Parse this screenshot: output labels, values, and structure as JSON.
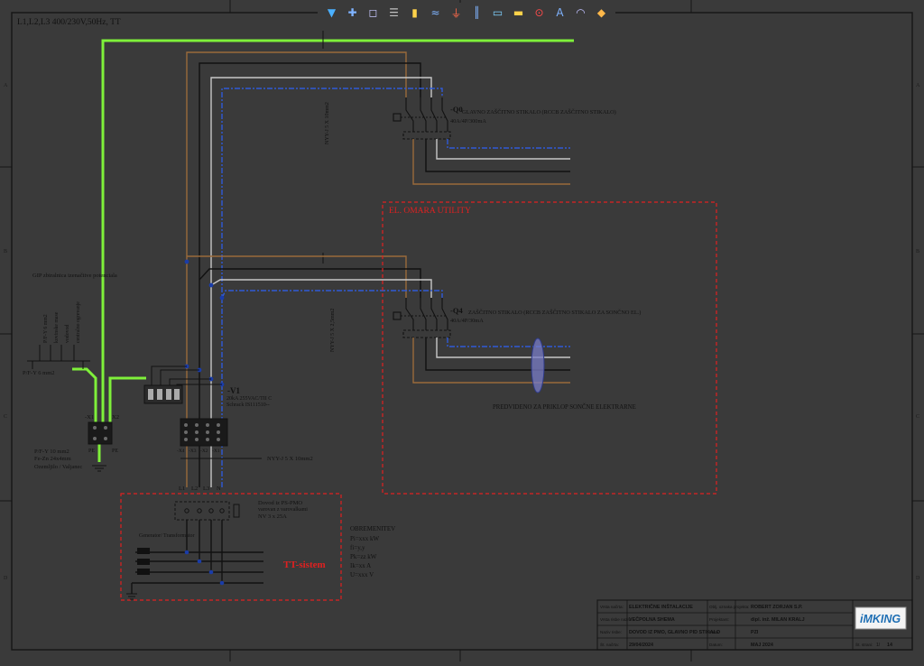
{
  "header": {
    "supply": "L1,L2,L3 400/230V,50Hz, TT"
  },
  "toolbar": {
    "icons": [
      "filter-icon",
      "crosshair-icon",
      "select-box-icon",
      "layers-icon",
      "component-icon",
      "wire-icon",
      "ground-icon",
      "bus-icon",
      "terminal-icon",
      "label-icon",
      "warning-icon",
      "text-icon",
      "arc-icon",
      "measure-icon"
    ],
    "glyphs": [
      "▼",
      "✚",
      "◻",
      "☰",
      "▮",
      "≈",
      "⏚",
      "║",
      "▭",
      "▬",
      "⊙",
      "A",
      "◠",
      "◆"
    ],
    "colors": [
      "#4ab0ff",
      "#7fb3ff",
      "#c8c8ff",
      "#c0c0c0",
      "#ffd24a",
      "#7fb3ff",
      "#ff6a4a",
      "#7fb3ff",
      "#7fd0ff",
      "#ffd24a",
      "#ff4a4a",
      "#7fb3ff",
      "#c0c0ff",
      "#ffb84a"
    ]
  },
  "cables": {
    "main": "NYY-J 5 X 10mm2",
    "utility": "NYY-J 5 X 2,5mm2",
    "bottom": "NYY-J 5 X 10mm2"
  },
  "q0": {
    "id": "-Q0",
    "desc": "GLAVNO ZAŠČITNO STIKALO (RCCB ZAŠČITNO STIKALO)",
    "rating": "40A/4P/300mA"
  },
  "q4": {
    "id": "-Q4",
    "desc": "ZAŠČITNO STIKALO (RCCB ZAŠČITNO STIKALO ZA SONČNO EL.)",
    "rating": "40A/4P/30mA"
  },
  "utility_box": {
    "title": "EL. OMARA UTILITY",
    "note": "PREDVIDENO ZA PRIKLOP SONČNE ELEKTRARNE"
  },
  "gip": {
    "title": "GIP zbiralnica izenačitve potenciala",
    "vertical": [
      "P/F-Y 6 mm2",
      "kovinske mase",
      "vodovod",
      "centralno ogrevanje"
    ],
    "pfy": "P/F-Y 6 mm2"
  },
  "x1": {
    "id": "-X1",
    "x2": "X2",
    "pe1": "PE",
    "pe2": "PE"
  },
  "earthing": {
    "line1": "P/F-Y 10 mm2",
    "line2": "Fe-Zn 24x4mm",
    "line3": "Ozemljilo / Valjanec"
  },
  "v1": {
    "id": "-V1",
    "line1": "20kA 255VAC/TII C",
    "line2": "Schrack IS111510--"
  },
  "x4": {
    "labels": [
      "-X4",
      "-X3",
      "-X2",
      "-X1"
    ]
  },
  "phases": {
    "labels": [
      "L1",
      "L2",
      "L3",
      "N"
    ]
  },
  "supply_box": {
    "line1": "Dovod iz PS-PMO",
    "line2": "varovan z varovalkami",
    "line3": "NV 3 x 25A",
    "generator": "Generator/ Transformator",
    "tt": "TT-sistem"
  },
  "load": {
    "title": "OBREMENITEV",
    "rows": [
      "Pi=xxx kW",
      "fi=y,y",
      "Pk=zz kW",
      "Ik=xx A",
      "U=xxx V"
    ]
  },
  "titleblock": {
    "rows": [
      {
        "l1": "Vrsta načrta:",
        "v1": "ELEKTRIČNE INŠTALACIJE",
        "l2": "Oblj. oznaka projekta:",
        "v2": "ROBERT ZORJAN S.P."
      },
      {
        "l1": "Vrsta risbe naziv:",
        "v1": "VEČPOLNA SHEMA",
        "l2": "Projektant:",
        "v2": "dipl. inž. MILAN KRALJ"
      },
      {
        "l1": "Naziv risbe:",
        "v1": "DOVOD IZ PMO, GLAVNO PID STIKALO",
        "l2": "Faza:",
        "v2": "PZI"
      },
      {
        "l1": "Št. načrta:",
        "v1": "29/04/2024",
        "l2": "Datum:",
        "v2": "MAJ 2024"
      }
    ],
    "sheet_label": "Št. strani:",
    "sheet_value": "1/",
    "sheet_total": "14",
    "logo": "iMKING"
  },
  "frame": {
    "rows": [
      "A",
      "B",
      "C",
      "D"
    ]
  },
  "colors": {
    "background": "#3a3a3a",
    "pe": "#7ff03a",
    "neutral": "#2f5bd8",
    "brown": "#9a6a3a",
    "black": "#111111",
    "gray": "#c8c8c8",
    "red": "#e02020"
  }
}
